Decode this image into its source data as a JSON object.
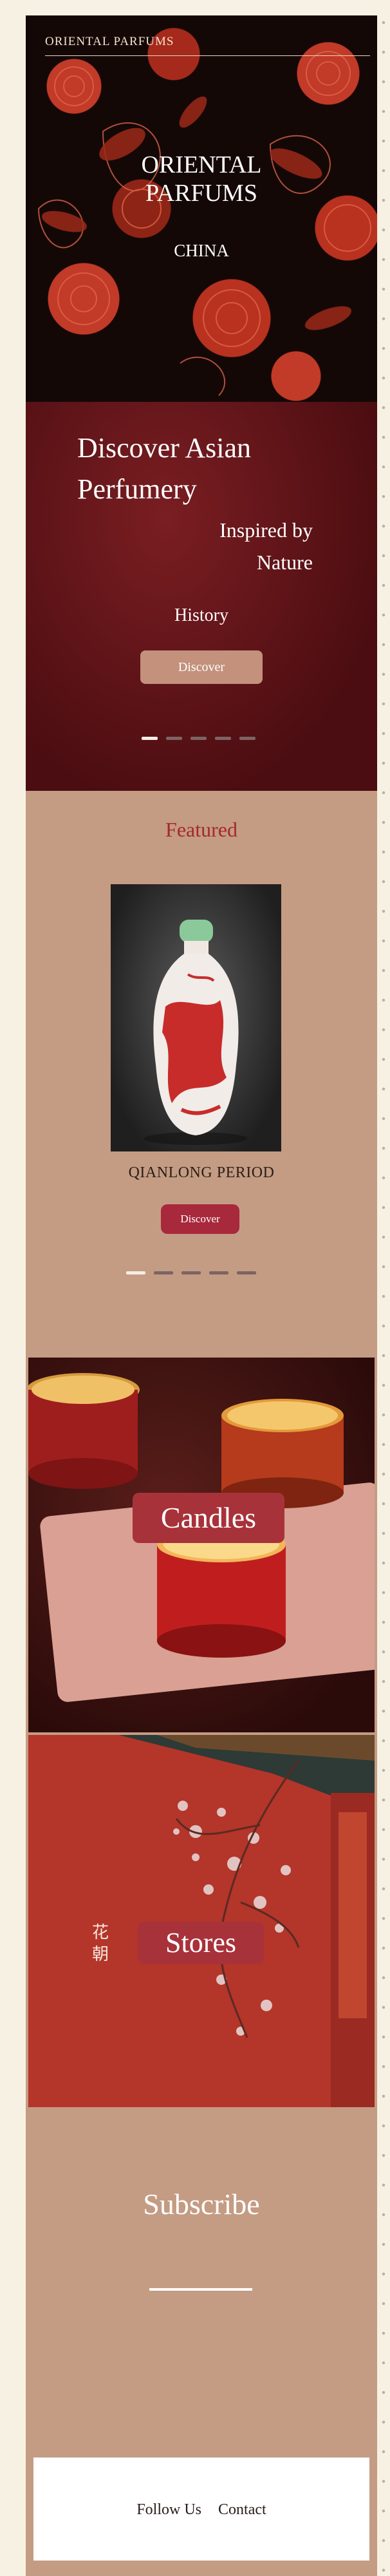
{
  "hero": {
    "brand": "ORIENTAL PARFUMS",
    "title_line1": "ORIENTAL",
    "title_line2": "PARFUMS",
    "subtitle": "CHINA"
  },
  "slider": {
    "title": "Discover Asian Perfumery",
    "subtitle_line1": "Inspired by",
    "subtitle_line2": "Nature",
    "history": "History",
    "button": "Discover",
    "indicator_count": 5,
    "active_index": 0
  },
  "featured": {
    "title": "Featured",
    "product_name": "QIANLONG PERIOD",
    "button": "Discover",
    "indicator_count": 5,
    "active_index": 0
  },
  "candles": {
    "label": "Candles"
  },
  "stores": {
    "label": "Stores",
    "chinese_text": "花朝"
  },
  "subscribe": {
    "title": "Subscribe"
  },
  "footer": {
    "follow": "Follow Us",
    "contact": "Contact"
  },
  "colors": {
    "frame": "#c49c83",
    "accent_red": "#a8283c",
    "page_bg": "#f7f1e3"
  }
}
